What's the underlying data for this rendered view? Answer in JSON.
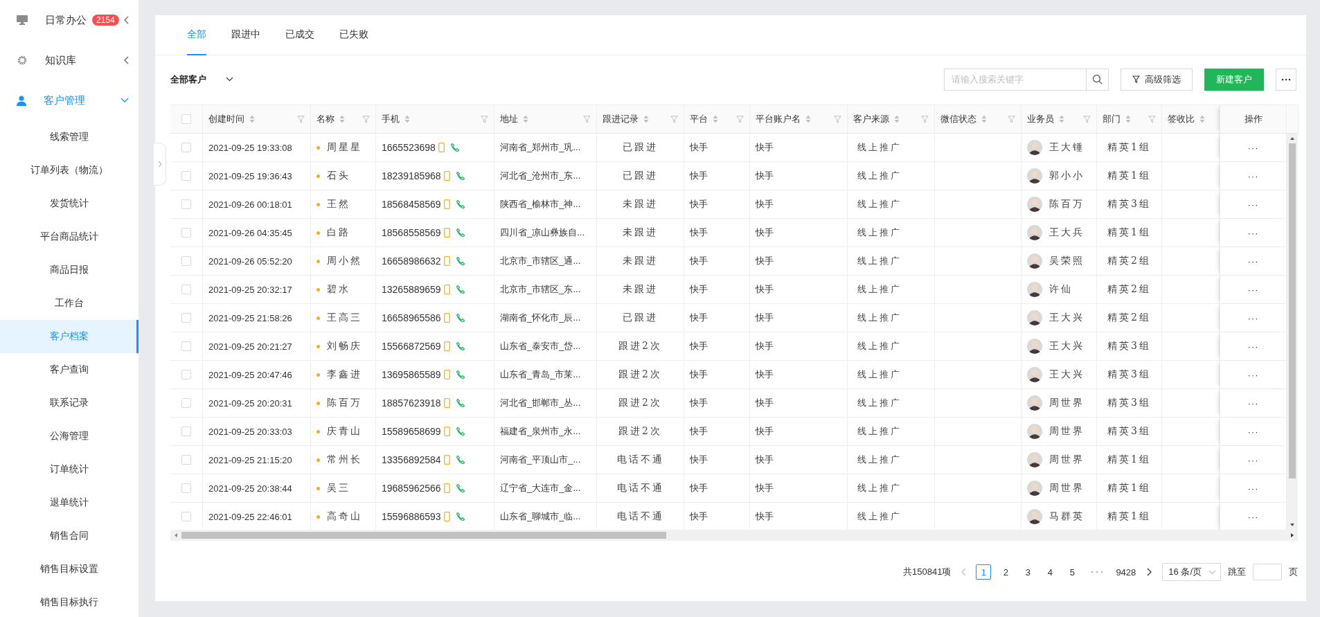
{
  "sidebar": {
    "items": [
      {
        "label": "日常办公",
        "badge": "2154",
        "expanded": false,
        "selected": false
      },
      {
        "label": "知识库",
        "expanded": false,
        "selected": false
      },
      {
        "label": "客户管理",
        "expanded": true,
        "selected": true,
        "children": [
          {
            "label": "线索管理",
            "selected": false
          },
          {
            "label": "订单列表（物流）",
            "selected": false
          },
          {
            "label": "发货统计",
            "selected": false
          },
          {
            "label": "平台商品统计",
            "selected": false
          },
          {
            "label": "商品日报",
            "selected": false
          },
          {
            "label": "工作台",
            "selected": false
          },
          {
            "label": "客户档案",
            "selected": true
          },
          {
            "label": "客户查询",
            "selected": false
          },
          {
            "label": "联系记录",
            "selected": false
          },
          {
            "label": "公海管理",
            "selected": false
          },
          {
            "label": "订单统计",
            "selected": false
          },
          {
            "label": "退单统计",
            "selected": false
          },
          {
            "label": "销售合同",
            "selected": false
          },
          {
            "label": "销售目标设置",
            "selected": false
          },
          {
            "label": "销售目标执行",
            "selected": false
          }
        ]
      }
    ]
  },
  "tabs": [
    {
      "label": "全部",
      "selected": true
    },
    {
      "label": "跟进中",
      "selected": false
    },
    {
      "label": "已成交",
      "selected": false
    },
    {
      "label": "已失败",
      "selected": false
    }
  ],
  "toolbar": {
    "scope": "全部客户",
    "search": {
      "placeholder": "请输入搜索关键字"
    },
    "filter_button": "高级筛选",
    "new_button": "新建客户"
  },
  "table": {
    "all_checked": false,
    "columns": [
      {
        "label": "创建时间",
        "sortable": true,
        "filterable": true
      },
      {
        "label": "名称",
        "sortable": true,
        "filterable": true
      },
      {
        "label": "手机",
        "sortable": true,
        "filterable": true
      },
      {
        "label": "地址",
        "sortable": true,
        "filterable": true
      },
      {
        "label": "跟进记录",
        "sortable": true,
        "filterable": true
      },
      {
        "label": "平台",
        "sortable": true,
        "filterable": true
      },
      {
        "label": "平台账户名",
        "sortable": true,
        "filterable": true
      },
      {
        "label": "客户来源",
        "sortable": true,
        "filterable": true
      },
      {
        "label": "微信状态",
        "sortable": true,
        "filterable": true
      },
      {
        "label": "业务员",
        "sortable": true,
        "filterable": true
      },
      {
        "label": "部门",
        "sortable": true,
        "filterable": true
      },
      {
        "label": "签收比",
        "sortable": true,
        "filterable": false
      },
      {
        "label": "操作",
        "sortable": false,
        "filterable": false
      }
    ],
    "rows": [
      {
        "checked": false,
        "created": "2021-09-25 19:33:08",
        "name": "周星星",
        "phone": "1665523698",
        "address": "河南省_郑州市_巩...",
        "follow": "已跟进",
        "platform": "快手",
        "account": "快手",
        "source": "线上推广",
        "sales": "王大锤",
        "dept": "精英1组",
        "action": "···"
      },
      {
        "checked": false,
        "created": "2021-09-25 19:36:43",
        "name": "石头",
        "phone": "18239185968",
        "address": "河北省_沧州市_东...",
        "follow": "已跟进",
        "platform": "快手",
        "account": "快手",
        "source": "线上推广",
        "sales": "郭小小",
        "dept": "精英1组",
        "action": "···"
      },
      {
        "checked": false,
        "created": "2021-09-26 00:18:01",
        "name": "王然",
        "phone": "18568458569",
        "address": "陕西省_榆林市_神...",
        "follow": "未跟进",
        "platform": "快手",
        "account": "快手",
        "source": "线上推广",
        "sales": "陈百万",
        "dept": "精英3组",
        "action": "···"
      },
      {
        "checked": false,
        "created": "2021-09-26 04:35:45",
        "name": "白路",
        "phone": "18568558569",
        "address": "四川省_凉山彝族自...",
        "follow": "未跟进",
        "platform": "快手",
        "account": "快手",
        "source": "线上推广",
        "sales": "王大兵",
        "dept": "精英1组",
        "action": "···"
      },
      {
        "checked": false,
        "created": "2021-09-26 05:52:20",
        "name": "周小然",
        "phone": "16658986632",
        "address": "北京市_市辖区_通...",
        "follow": "未跟进",
        "platform": "快手",
        "account": "快手",
        "source": "线上推广",
        "sales": "吴荣照",
        "dept": "精英2组",
        "action": "···"
      },
      {
        "checked": false,
        "created": "2021-09-25 20:32:17",
        "name": "碧水",
        "phone": "13265889659",
        "address": "北京市_市辖区_东...",
        "follow": "未跟进",
        "platform": "快手",
        "account": "快手",
        "source": "线上推广",
        "sales": "许仙",
        "dept": "精英2组",
        "action": "···"
      },
      {
        "checked": false,
        "created": "2021-09-25 21:58:26",
        "name": "王高三",
        "phone": "16658965586",
        "address": "湖南省_怀化市_辰...",
        "follow": "已跟进",
        "platform": "快手",
        "account": "快手",
        "source": "线上推广",
        "sales": "王大兴",
        "dept": "精英2组",
        "action": "···"
      },
      {
        "checked": false,
        "created": "2021-09-25 20:21:27",
        "name": "刘畅庆",
        "phone": "15566872569",
        "address": "山东省_泰安市_岱...",
        "follow": "跟进2次",
        "platform": "快手",
        "account": "快手",
        "source": "线上推广",
        "sales": "王大兴",
        "dept": "精英3组",
        "action": "···"
      },
      {
        "checked": false,
        "created": "2021-09-25 20:47:46",
        "name": "李鑫进",
        "phone": "13695865589",
        "address": "山东省_青岛_市莱...",
        "follow": "跟进2次",
        "platform": "快手",
        "account": "快手",
        "source": "线上推广",
        "sales": "王大兴",
        "dept": "精英3组",
        "action": "···"
      },
      {
        "checked": false,
        "created": "2021-09-25 20:20:31",
        "name": "陈百万",
        "phone": "18857623918",
        "address": "河北省_邯郸市_丛...",
        "follow": "跟进2次",
        "platform": "快手",
        "account": "快手",
        "source": "线上推广",
        "sales": "周世界",
        "dept": "精英3组",
        "action": "···"
      },
      {
        "checked": false,
        "created": "2021-09-25 20:33:03",
        "name": "庆青山",
        "phone": "15589658699",
        "address": "福建省_泉州市_永...",
        "follow": "跟进2次",
        "platform": "快手",
        "account": "快手",
        "source": "线上推广",
        "sales": "周世界",
        "dept": "精英3组",
        "action": "···"
      },
      {
        "checked": false,
        "created": "2021-09-25 21:15:20",
        "name": "常州长",
        "phone": "13356892584",
        "address": "河南省_平顶山市_...",
        "follow": "电话不通",
        "platform": "快手",
        "account": "快手",
        "source": "线上推广",
        "sales": "周世界",
        "dept": "精英1组",
        "action": "···"
      },
      {
        "checked": false,
        "created": "2021-09-25 20:38:44",
        "name": "吴三",
        "phone": "19685962566",
        "address": "辽宁省_大连市_金...",
        "follow": "电话不通",
        "platform": "快手",
        "account": "快手",
        "source": "线上推广",
        "sales": "周世界",
        "dept": "精英1组",
        "action": "···"
      },
      {
        "checked": false,
        "created": "2021-09-25 22:46:01",
        "name": "高奇山",
        "phone": "15596886593",
        "address": "山东省_聊城市_临...",
        "follow": "电话不通",
        "platform": "快手",
        "account": "快手",
        "source": "线上推广",
        "sales": "马群英",
        "dept": "精英1组",
        "action": "···"
      }
    ]
  },
  "pagination": {
    "total": "共150841项",
    "pages": [
      {
        "label": "1",
        "selected": true
      },
      {
        "label": "2",
        "selected": false
      },
      {
        "label": "3",
        "selected": false
      },
      {
        "label": "4",
        "selected": false
      },
      {
        "label": "5",
        "selected": false
      }
    ],
    "last_page": "9428",
    "page_size": "16 条/页",
    "jump_label": "跳至",
    "jump_suffix": "页"
  }
}
